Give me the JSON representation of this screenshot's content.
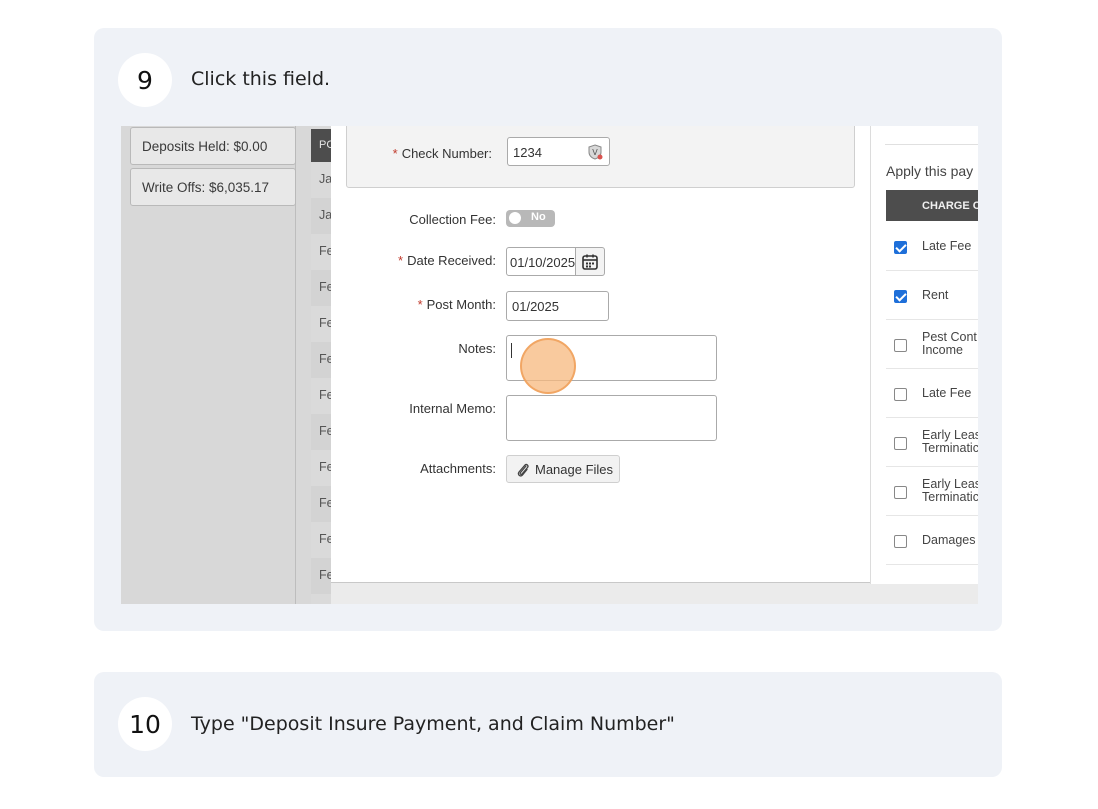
{
  "step9": {
    "number": "9",
    "instruction": "Click this field.",
    "screenshot": {
      "left_panel": {
        "deposits_held": "Deposits Held: $0.00",
        "write_offs": "Write Offs: $6,035.17"
      },
      "mid_table": {
        "header": "PC",
        "rows": [
          "Ja",
          "Ja",
          "Fe",
          "Fe",
          "Fe",
          "Fe",
          "Fe",
          "Fe",
          "Fe",
          "Fe",
          "Fe",
          "Fe"
        ]
      },
      "form": {
        "check_number_label": "Check Number:",
        "check_number_value": "1234",
        "collection_fee_label": "Collection Fee:",
        "collection_fee_value": "No",
        "date_received_label": "Date Received:",
        "date_received_value": "01/10/2025",
        "post_month_label": "Post Month:",
        "post_month_value": "01/2025",
        "notes_label": "Notes:",
        "internal_memo_label": "Internal Memo:",
        "attachments_label": "Attachments:",
        "manage_files_label": "Manage Files",
        "required_mark": "*"
      },
      "right_panel": {
        "apply_text": "Apply this pay",
        "header": "CHARGE C",
        "charges": [
          {
            "label": "Late Fee",
            "checked": true
          },
          {
            "label": "Rent",
            "checked": true
          },
          {
            "label": "Pest Cont\nIncome",
            "checked": false
          },
          {
            "label": "Late Fee",
            "checked": false
          },
          {
            "label": "Early Leas\nTerminatic",
            "checked": false
          },
          {
            "label": "Early Leas\nTerminatic",
            "checked": false
          },
          {
            "label": "Damages",
            "checked": false
          }
        ]
      }
    }
  },
  "step10": {
    "number": "10",
    "instruction": "Type \"Deposit Insure Payment, and Claim Number\""
  },
  "colors": {
    "card_bg": "#eff2f7",
    "click_highlight": "#f7b87e",
    "checkbox_checked": "#1e6fd9",
    "table_header": "#4d4d4d"
  }
}
